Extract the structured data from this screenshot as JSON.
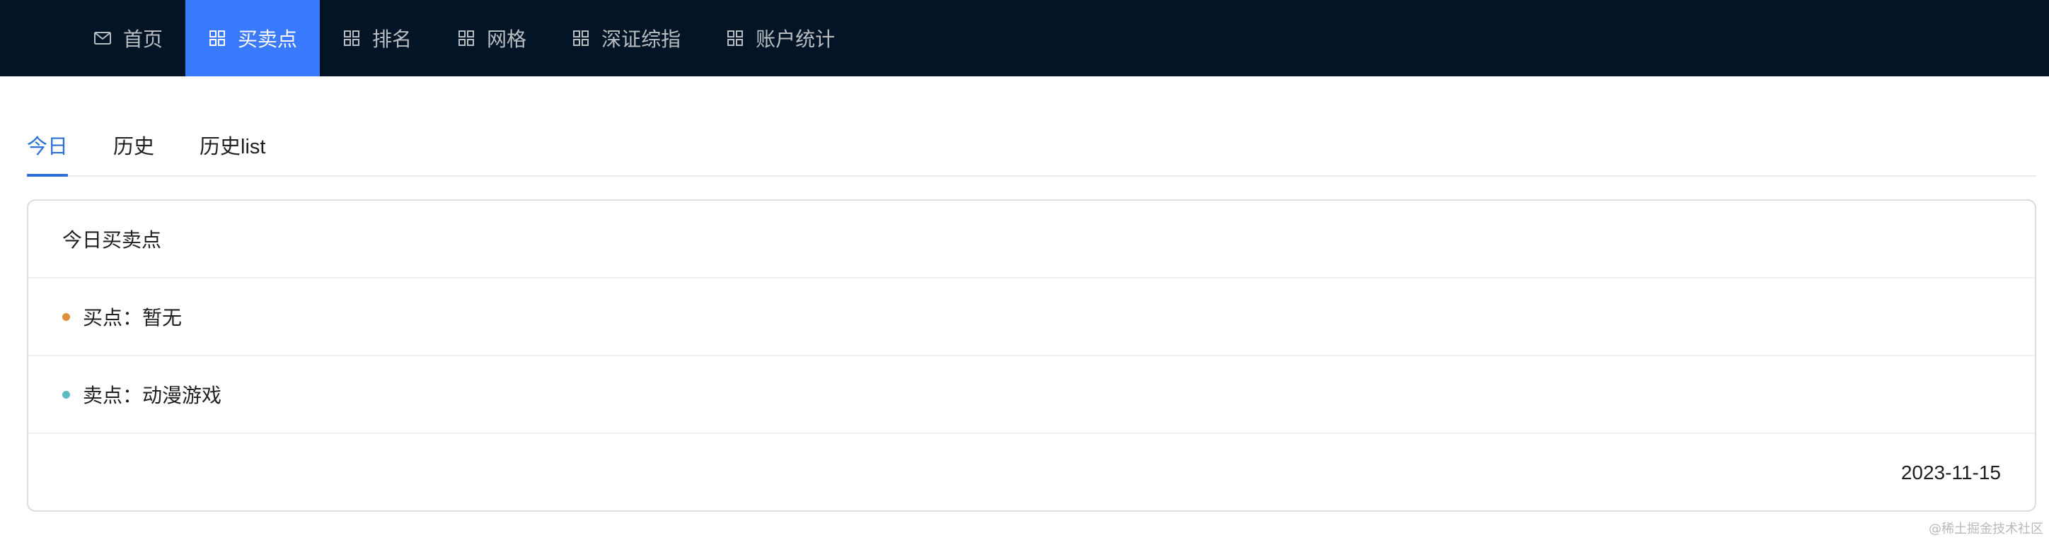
{
  "nav": {
    "items": [
      {
        "label": "首页",
        "icon": "mail-icon"
      },
      {
        "label": "买卖点",
        "icon": "grid-icon",
        "active": true
      },
      {
        "label": "排名",
        "icon": "grid-icon"
      },
      {
        "label": "网格",
        "icon": "grid-icon"
      },
      {
        "label": "深证综指",
        "icon": "grid-icon"
      },
      {
        "label": "账户统计",
        "icon": "grid-icon"
      }
    ],
    "bg_color": "#031426",
    "active_color": "#3a7afe"
  },
  "tabs": {
    "items": [
      {
        "label": "今日",
        "active": true
      },
      {
        "label": "历史"
      },
      {
        "label": "历史list"
      }
    ],
    "active_color": "#2f6fd6"
  },
  "card": {
    "title": "今日买卖点",
    "buy": {
      "label": "买点：暂无",
      "dot_color": "#e0903a"
    },
    "sell": {
      "label": "卖点：动漫游戏",
      "dot_color": "#5bbcc4"
    },
    "date": "2023-11-15"
  },
  "watermark": "@稀土掘金技术社区"
}
